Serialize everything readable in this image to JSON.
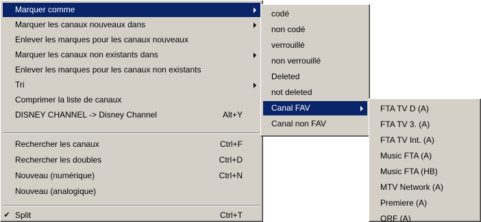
{
  "main_menu": {
    "items": [
      {
        "label": "Marquer comme"
      },
      {
        "label": "Marquer les canaux nouveaux dans"
      },
      {
        "label": "Enlever les marques pour les canaux nouveaux"
      },
      {
        "label": "Marquer les canaux non existants dans"
      },
      {
        "label": "Enlever les marques pour les canaux non existants"
      },
      {
        "label": "Tri"
      },
      {
        "label": "Comprimer la liste de canaux"
      },
      {
        "label": "DISNEY CHANNEL -> Disney Channel",
        "shortcut": "Alt+Y"
      },
      {
        "label": "Rechercher les canaux",
        "shortcut": "Ctrl+F"
      },
      {
        "label": "Rechercher les doubles",
        "shortcut": "Ctrl+D"
      },
      {
        "label": "Nouveau (numérique)",
        "shortcut": "Ctrl+N"
      },
      {
        "label": "Nouveau (analogique)"
      },
      {
        "label": "Split",
        "shortcut": "Ctrl+T",
        "check": "✔"
      }
    ]
  },
  "mark_as_submenu": {
    "items": [
      {
        "label": "codé"
      },
      {
        "label": "non codé"
      },
      {
        "label": "verrouillé"
      },
      {
        "label": "non verrouillé"
      },
      {
        "label": "Deleted"
      },
      {
        "label": "not deleted"
      },
      {
        "label": "Canal FAV"
      },
      {
        "label": "Canal non FAV"
      }
    ]
  },
  "fav_submenu": {
    "items": [
      {
        "label": "FTA TV D (A)"
      },
      {
        "label": "FTA TV 3. (A)"
      },
      {
        "label": "FTA TV Int. (A)"
      },
      {
        "label": "Music FTA (A)"
      },
      {
        "label": "Music FTA (HB)"
      },
      {
        "label": "MTV Network (A)"
      },
      {
        "label": "Premiere (A)"
      },
      {
        "label": "ORF (A)"
      }
    ]
  }
}
